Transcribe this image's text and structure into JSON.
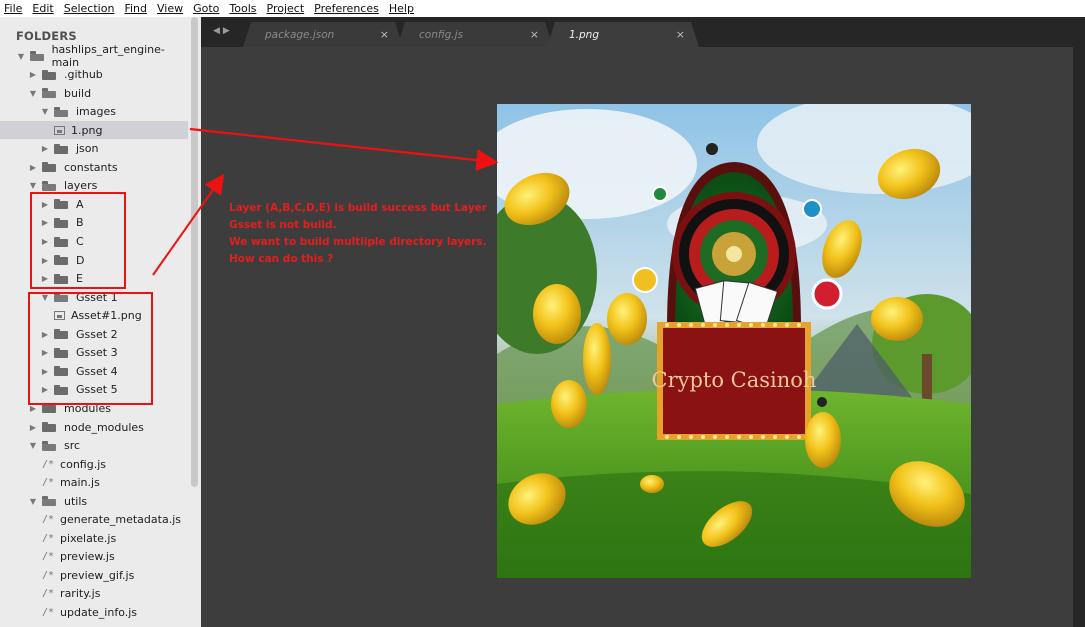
{
  "menu": [
    "File",
    "Edit",
    "Selection",
    "Find",
    "View",
    "Goto",
    "Tools",
    "Project",
    "Preferences",
    "Help"
  ],
  "sidebar": {
    "header": "FOLDERS",
    "tree": [
      {
        "label": "hashlips_art_engine-main",
        "type": "folder",
        "open": true,
        "indent": 0
      },
      {
        "label": ".github",
        "type": "folder",
        "open": false,
        "indent": 1
      },
      {
        "label": "build",
        "type": "folder",
        "open": true,
        "indent": 1
      },
      {
        "label": "images",
        "type": "folder",
        "open": true,
        "indent": 2
      },
      {
        "label": "1.png",
        "type": "image",
        "indent": 3,
        "selected": true
      },
      {
        "label": "json",
        "type": "folder",
        "open": false,
        "indent": 2
      },
      {
        "label": "constants",
        "type": "folder",
        "open": false,
        "indent": 1
      },
      {
        "label": "layers",
        "type": "folder",
        "open": true,
        "indent": 1
      },
      {
        "label": "A",
        "type": "folder",
        "open": false,
        "indent": 2
      },
      {
        "label": "B",
        "type": "folder",
        "open": false,
        "indent": 2
      },
      {
        "label": "C",
        "type": "folder",
        "open": false,
        "indent": 2
      },
      {
        "label": "D",
        "type": "folder",
        "open": false,
        "indent": 2
      },
      {
        "label": "E",
        "type": "folder",
        "open": false,
        "indent": 2
      },
      {
        "label": "Gsset 1",
        "type": "folder",
        "open": true,
        "indent": 2
      },
      {
        "label": "Asset#1.png",
        "type": "image",
        "indent": 3
      },
      {
        "label": "Gsset 2",
        "type": "folder",
        "open": false,
        "indent": 2
      },
      {
        "label": "Gsset 3",
        "type": "folder",
        "open": false,
        "indent": 2
      },
      {
        "label": "Gsset 4",
        "type": "folder",
        "open": false,
        "indent": 2
      },
      {
        "label": "Gsset 5",
        "type": "folder",
        "open": false,
        "indent": 2
      },
      {
        "label": "modules",
        "type": "folder",
        "open": false,
        "indent": 1
      },
      {
        "label": "node_modules",
        "type": "folder",
        "open": false,
        "indent": 1
      },
      {
        "label": "src",
        "type": "folder",
        "open": true,
        "indent": 1
      },
      {
        "label": "config.js",
        "type": "code",
        "indent": 2
      },
      {
        "label": "main.js",
        "type": "code",
        "indent": 2
      },
      {
        "label": "utils",
        "type": "folder",
        "open": true,
        "indent": 1
      },
      {
        "label": "generate_metadata.js",
        "type": "code",
        "indent": 2
      },
      {
        "label": "pixelate.js",
        "type": "code",
        "indent": 2
      },
      {
        "label": "preview.js",
        "type": "code",
        "indent": 2
      },
      {
        "label": "preview_gif.js",
        "type": "code",
        "indent": 2
      },
      {
        "label": "rarity.js",
        "type": "code",
        "indent": 2
      },
      {
        "label": "update_info.js",
        "type": "code",
        "indent": 2
      }
    ]
  },
  "tabs": [
    {
      "label": "package.json",
      "active": false
    },
    {
      "label": "config.js",
      "active": false
    },
    {
      "label": "1.png",
      "active": true
    }
  ],
  "tab_close_glyph": "×",
  "preview": {
    "sign_text": "Crypto Casinoh"
  },
  "annotation": {
    "lines": [
      "Layer (A,B,C,D,E) is build success but Layer",
      "Gsset is not build.",
      "We want to build multiiple directory layers.",
      "How can do this ?"
    ],
    "color": "#e41e1e"
  },
  "colors": {
    "sidebar_bg": "#ebebeb",
    "editor_bg": "#3d3d3d",
    "tabbar_bg": "#262626"
  }
}
